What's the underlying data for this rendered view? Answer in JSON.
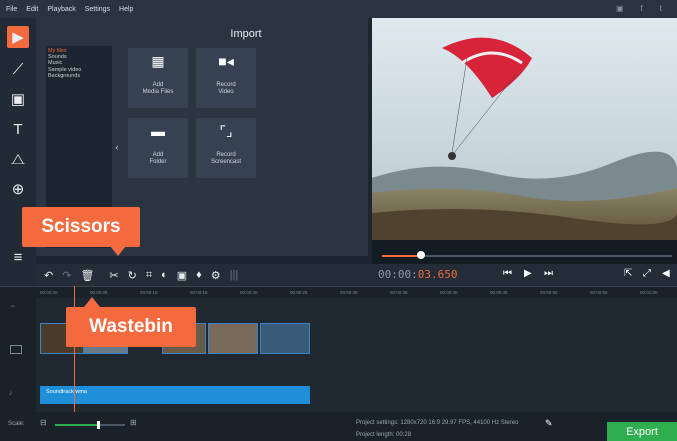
{
  "menu": {
    "items": [
      "File",
      "Edit",
      "Playback",
      "Settings",
      "Help"
    ],
    "social": [
      "yt-icon",
      "fb-icon",
      "tw-icon"
    ]
  },
  "sidebar_tools": [
    {
      "icon": "import-icon",
      "active": true
    },
    {
      "icon": "magic-wand-icon",
      "active": false
    },
    {
      "icon": "filters-icon",
      "active": false
    },
    {
      "icon": "titles-icon",
      "active": false
    },
    {
      "icon": "shapes-icon",
      "active": false
    },
    {
      "icon": "zoom-icon",
      "active": false
    },
    {
      "icon": "more-icon",
      "active": false
    }
  ],
  "import": {
    "title": "Import",
    "categories": [
      "My files",
      "Sounds",
      "Music",
      "Sample video",
      "Backgrounds"
    ],
    "tiles": [
      {
        "line1": "Add",
        "line2": "Media Files",
        "icon": "media-files-icon"
      },
      {
        "line1": "Record",
        "line2": "Video",
        "icon": "record-video-icon"
      },
      {
        "line1": "Add",
        "line2": "Folder",
        "icon": "folder-icon"
      },
      {
        "line1": "Record",
        "line2": "Screencast",
        "icon": "screencast-icon"
      }
    ]
  },
  "player": {
    "timecode_prefix": "00:00:",
    "timecode_active": "03.650",
    "progress": 0.13
  },
  "ruler_ticks": [
    "00:00:00",
    "00:00:05",
    "00:00:10",
    "00:00:15",
    "00:00:20",
    "00:00:25",
    "00:00:30",
    "00:00:35",
    "00:00:40",
    "00:00:45",
    "00:00:50",
    "00:00:55",
    "00:01:00"
  ],
  "audio_clip": {
    "label": "Soundtrack.wma"
  },
  "status": {
    "scale_label": "Scale:",
    "project_settings": "Project settings:  1280x720 16:9 29.97 FPS, 44100 Hz Stereo",
    "project_length": "Project length:   00:28"
  },
  "export_label": "Export",
  "callouts": {
    "scissors": "Scissors",
    "wastebin": "Wastebin"
  },
  "colors": {
    "accent": "#f26a3d",
    "export": "#2fae4f",
    "audio": "#1e8fd8"
  }
}
